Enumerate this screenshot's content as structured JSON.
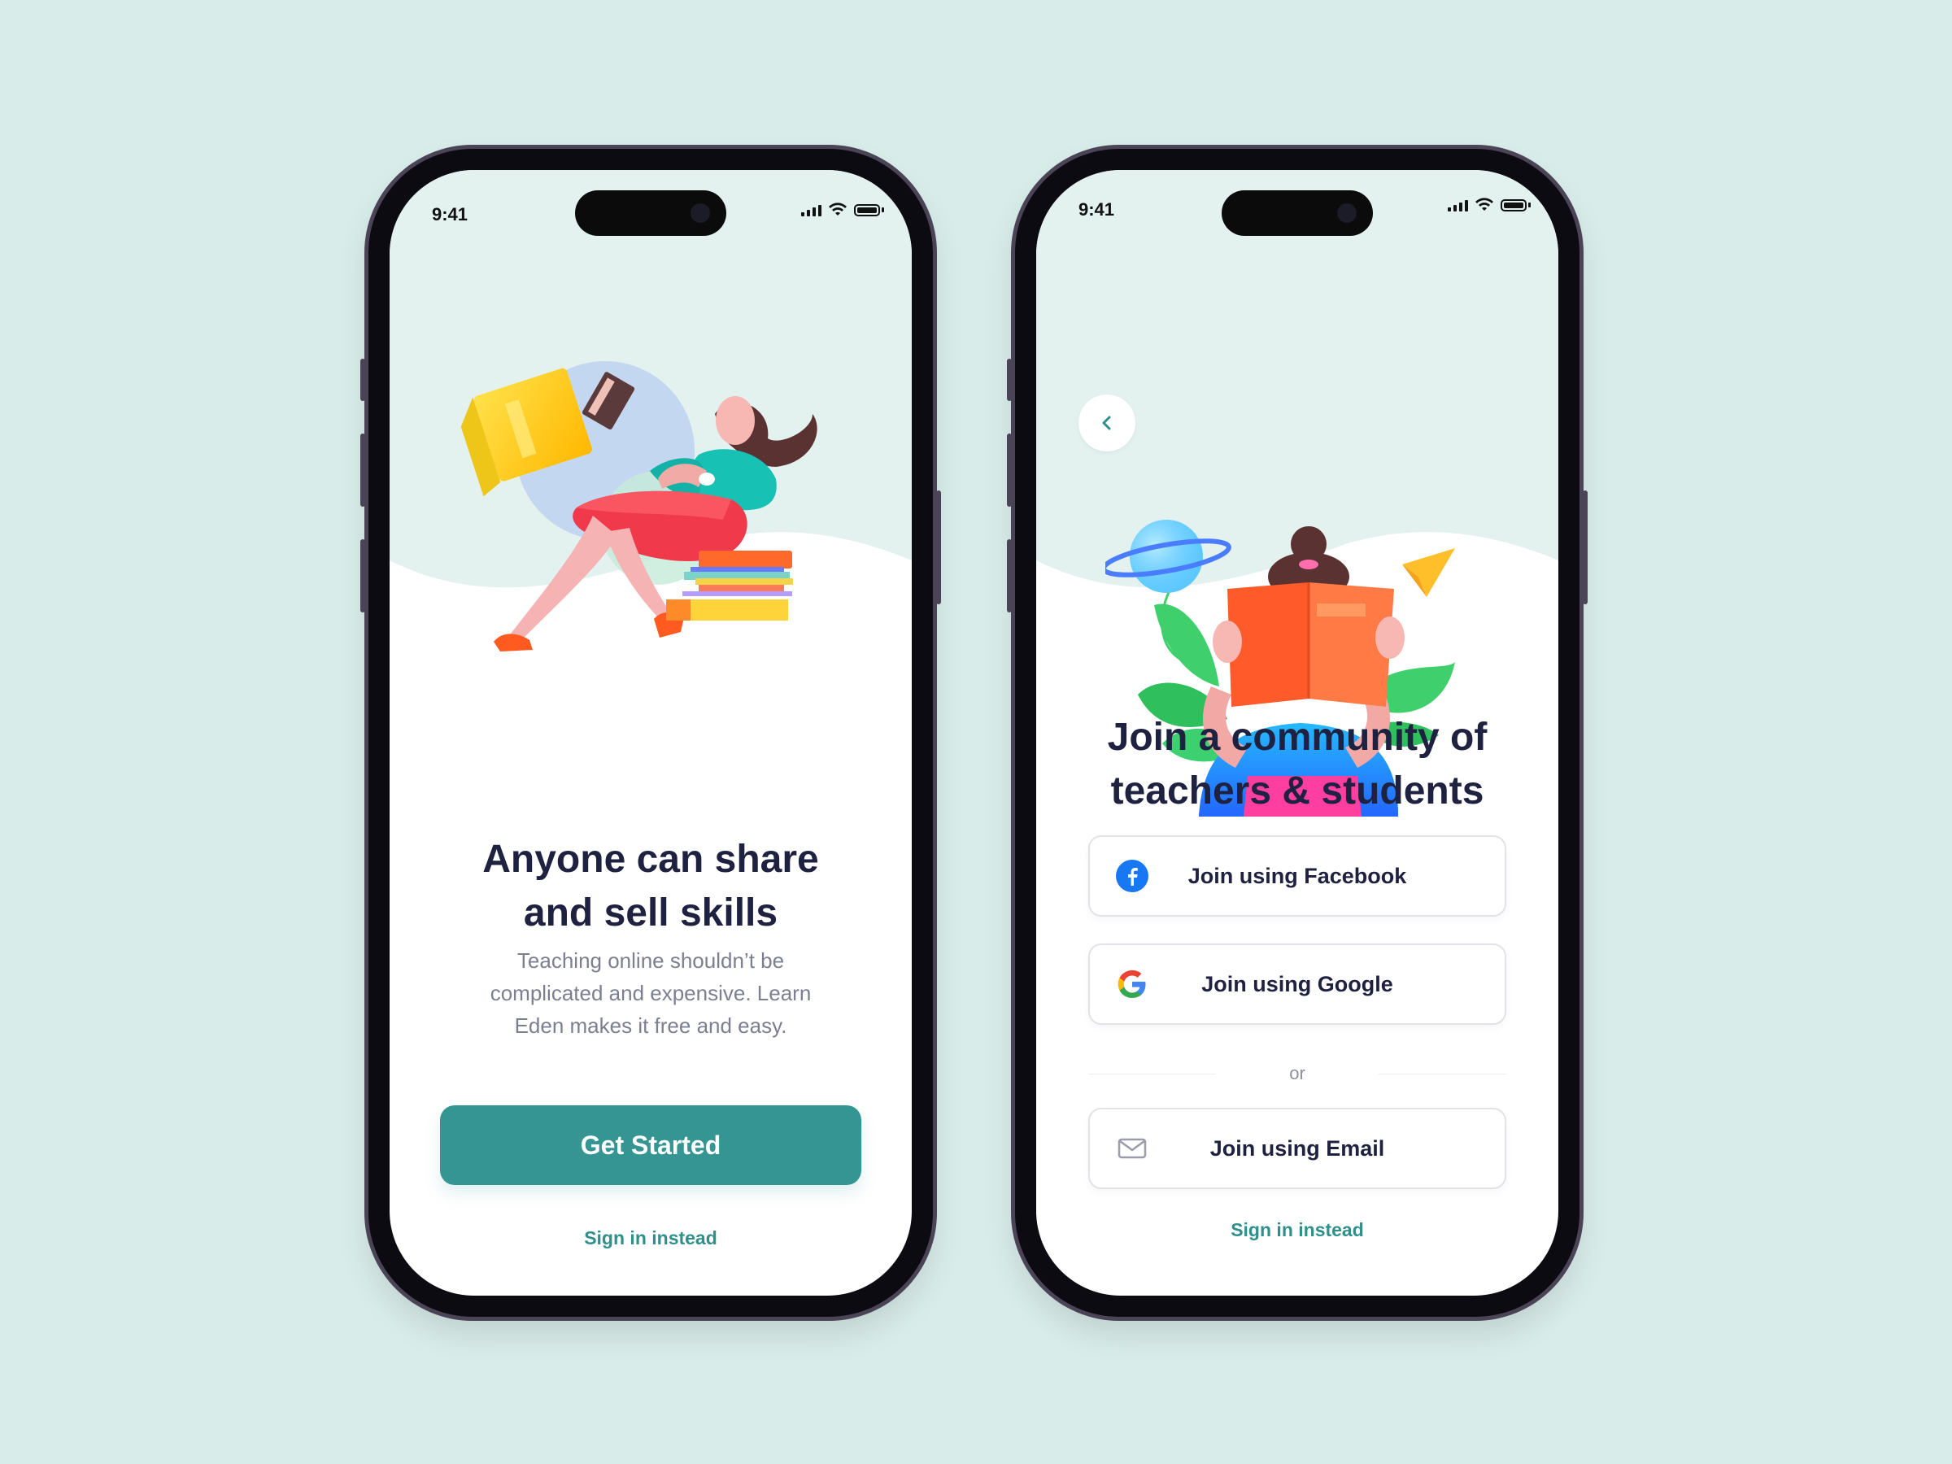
{
  "phone1": {
    "status": {
      "time": "9:41"
    },
    "title_line1": "Anyone can share",
    "title_line2": "and sell skills",
    "subtitle_line1": "Teaching online shouldn’t be",
    "subtitle_line2": "complicated and expensive. Learn",
    "subtitle_line3": "Eden makes it free and easy.",
    "primary_button": "Get Started",
    "secondary_link": "Sign in instead",
    "illustration": "woman-reading-with-books"
  },
  "phone2": {
    "status": {
      "time": "9:41"
    },
    "back_icon": "chevron-left-icon",
    "title_line1": "Join a community of",
    "title_line2": "teachers & students",
    "buttons": [
      {
        "label": "Join using Facebook",
        "icon": "facebook-icon"
      },
      {
        "label": "Join using Google",
        "icon": "google-icon"
      },
      {
        "label": "Join using Email",
        "icon": "mail-icon"
      }
    ],
    "divider_text": "or",
    "secondary_link": "Sign in instead",
    "illustration": "person-reading-book-with-planet"
  },
  "colors": {
    "background": "#d8ecea",
    "accent": "#349592",
    "heading": "#1f2140",
    "body_text": "#7c7f90",
    "hero_bg": "#e3f1ef"
  }
}
